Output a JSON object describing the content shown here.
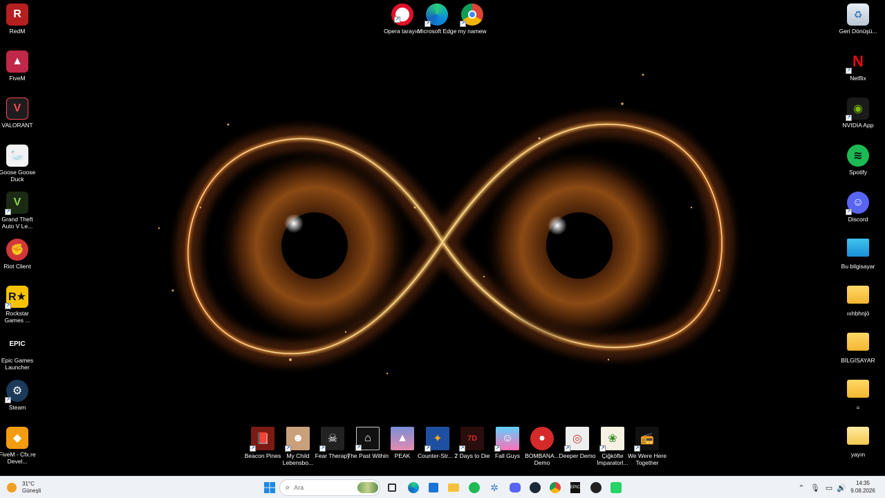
{
  "desktop": {
    "left_icons": [
      {
        "label": "RedM",
        "icon": "redm-icon"
      },
      {
        "label": "FiveM",
        "icon": "fivem-icon"
      },
      {
        "label": "VALORANT",
        "icon": "valorant-icon"
      },
      {
        "label": "Goose Goose Duck",
        "icon": "goose-icon"
      },
      {
        "label": "Grand Theft Auto V Le...",
        "icon": "gta-icon"
      },
      {
        "label": "Riot Client",
        "icon": "riot-icon"
      },
      {
        "label": "Rockstar Games ...",
        "icon": "rockstar-icon"
      },
      {
        "label": "Epic Games Launcher",
        "icon": "epic-icon"
      },
      {
        "label": "Steam",
        "icon": "steam-icon"
      },
      {
        "label": "FiveM - Cfx.re Devel...",
        "icon": "fivem-dev-icon"
      }
    ],
    "top_icons": [
      {
        "label": "Opera tarayıcı",
        "icon": "opera-icon"
      },
      {
        "label": "Microsoft Edge",
        "icon": "edge-icon"
      },
      {
        "label": "my namew",
        "icon": "chrome-icon"
      }
    ],
    "right_icons": [
      {
        "label": "Geri Dönüşü...",
        "icon": "recycle-bin-icon"
      },
      {
        "label": "Netflix",
        "icon": "netflix-icon"
      },
      {
        "label": "NVIDIA App",
        "icon": "nvidia-icon"
      },
      {
        "label": "Spotify",
        "icon": "spotify-icon"
      },
      {
        "label": "Discord",
        "icon": "discord-icon"
      },
      {
        "label": "Bu bilgisayar",
        "icon": "computer-icon"
      },
      {
        "label": "ıııhbhnjö",
        "icon": "folder-icon"
      },
      {
        "label": "BİLGİSAYAR",
        "icon": "folder-icon"
      },
      {
        "label": "=",
        "icon": "folder-icon"
      },
      {
        "label": "yayın",
        "icon": "folder-icon"
      }
    ],
    "bottom_icons": [
      {
        "label": "Beacon Pines",
        "icon": "beacon-pines-icon"
      },
      {
        "label": "My Child Lebensbo...",
        "icon": "my-child-icon"
      },
      {
        "label": "Fear Therapy",
        "icon": "fear-therapy-icon"
      },
      {
        "label": "The Past Within",
        "icon": "past-within-icon"
      },
      {
        "label": "PEAK",
        "icon": "peak-icon"
      },
      {
        "label": "Counter-Str... 2",
        "icon": "cs2-icon"
      },
      {
        "label": "7 Days to Die",
        "icon": "seven-days-icon"
      },
      {
        "label": "Fall Guys",
        "icon": "fall-guys-icon"
      },
      {
        "label": "BOMBANA... Demo",
        "icon": "bombana-icon"
      },
      {
        "label": "Deeper Demo",
        "icon": "deeper-icon"
      },
      {
        "label": "Çiğköfte İmparatorl...",
        "icon": "cigkofte-icon"
      },
      {
        "label": "We Were Here Together",
        "icon": "we-were-here-icon"
      }
    ]
  },
  "taskbar": {
    "weather_temp": "31°C",
    "weather_desc": "Güneşli",
    "search_placeholder": "Ara",
    "clock_time": "14:35",
    "clock_date": "9.08.2026"
  }
}
